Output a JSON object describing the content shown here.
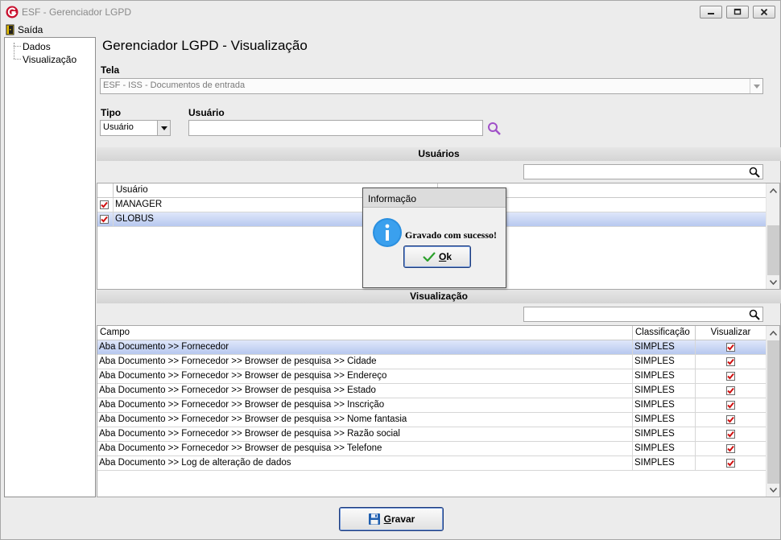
{
  "window": {
    "title": "ESF - Gerenciador LGPD"
  },
  "menu": {
    "exit_label": "Saída"
  },
  "tree": {
    "items": [
      "Dados",
      "Visualização"
    ]
  },
  "page": {
    "title": "Gerenciador LGPD - Visualização"
  },
  "tela": {
    "label": "Tela",
    "value": "ESF - ISS - Documentos de entrada"
  },
  "tipo": {
    "label": "Tipo",
    "value": "Usuário"
  },
  "usuario": {
    "label": "Usuário",
    "value": ""
  },
  "usuarios_section": {
    "title": "Usuários",
    "filter_value": "",
    "columns": [
      "Usuário",
      ""
    ],
    "rows": [
      {
        "name": "MANAGER",
        "checked": true,
        "selected": false
      },
      {
        "name": "GLOBUS",
        "checked": true,
        "selected": true
      }
    ]
  },
  "visualizacao_section": {
    "title": "Visualização",
    "filter_value": "",
    "columns": [
      "Campo",
      "Classificação",
      "Visualizar"
    ],
    "rows": [
      {
        "campo": "Aba Documento >> Fornecedor",
        "classificacao": "SIMPLES",
        "visualizar": true,
        "selected": true
      },
      {
        "campo": "Aba Documento >> Fornecedor >> Browser de pesquisa >> Cidade",
        "classificacao": "SIMPLES",
        "visualizar": true,
        "selected": false
      },
      {
        "campo": "Aba Documento >> Fornecedor >> Browser de pesquisa >> Endereço",
        "classificacao": "SIMPLES",
        "visualizar": true,
        "selected": false
      },
      {
        "campo": "Aba Documento >> Fornecedor >> Browser de pesquisa >> Estado",
        "classificacao": "SIMPLES",
        "visualizar": true,
        "selected": false
      },
      {
        "campo": "Aba Documento >> Fornecedor >> Browser de pesquisa >> Inscrição",
        "classificacao": "SIMPLES",
        "visualizar": true,
        "selected": false
      },
      {
        "campo": "Aba Documento >> Fornecedor >> Browser de pesquisa >> Nome fantasia",
        "classificacao": "SIMPLES",
        "visualizar": true,
        "selected": false
      },
      {
        "campo": "Aba Documento >> Fornecedor >> Browser de pesquisa >> Razão social",
        "classificacao": "SIMPLES",
        "visualizar": true,
        "selected": false
      },
      {
        "campo": "Aba Documento >> Fornecedor >> Browser de pesquisa >> Telefone",
        "classificacao": "SIMPLES",
        "visualizar": true,
        "selected": false
      },
      {
        "campo": "Aba Documento >> Log de alteração de dados",
        "classificacao": "SIMPLES",
        "visualizar": true,
        "selected": false
      }
    ]
  },
  "dialog": {
    "title": "Informação",
    "message": "Gravado com sucesso!",
    "ok_first": "O",
    "ok_rest": "k"
  },
  "footer": {
    "save_first": "G",
    "save_rest": "ravar"
  },
  "colors": {
    "selection": "#b7c8ef",
    "check": "#d01010",
    "accent_blue": "#1c3a7a",
    "info_blue": "#2a8fdf",
    "search_purple": "#a050c8"
  },
  "icons": [
    "app-logo-icon",
    "exit-door-icon",
    "search-icon",
    "info-icon",
    "checkmark-icon",
    "floppy-disk-icon",
    "chevron-down-icon",
    "chevron-up-icon"
  ]
}
